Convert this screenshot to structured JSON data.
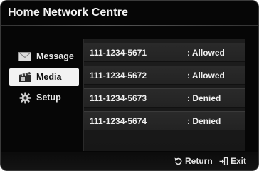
{
  "header": {
    "title": "Home Network Centre"
  },
  "sidebar": {
    "items": [
      {
        "label": "Message",
        "icon": "envelope-icon"
      },
      {
        "label": "Media",
        "icon": "media-clapper-icon",
        "selected": true
      },
      {
        "label": "Setup",
        "icon": "gear-icon"
      }
    ]
  },
  "devices": [
    {
      "number": "111-1234-5671",
      "status": ": Allowed"
    },
    {
      "number": "111-1234-5672",
      "status": ": Allowed"
    },
    {
      "number": "111-1234-5673",
      "status": ": Denied"
    },
    {
      "number": "111-1234-5674",
      "status": ": Denied"
    }
  ],
  "footer": {
    "return_label": "Return",
    "return_icon": "return-icon",
    "exit_label": "Exit",
    "exit_icon": "exit-icon"
  },
  "colors": {
    "background": "#060606",
    "selected": "#f2f2f2",
    "row": "#2a2a2a",
    "text": "#efefef"
  }
}
